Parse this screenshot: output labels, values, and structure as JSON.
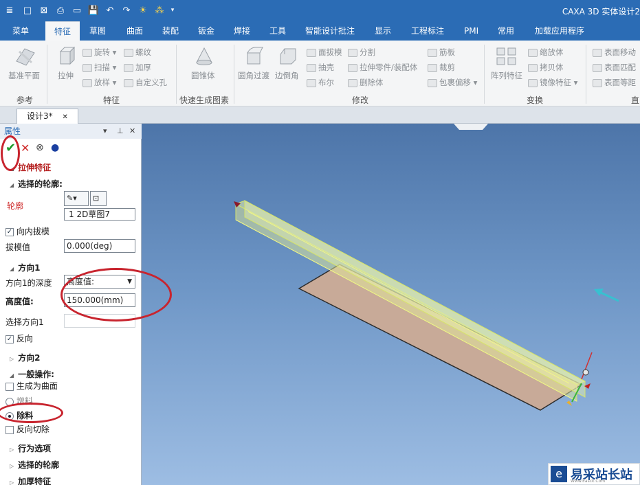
{
  "title_bar": {
    "app_title": "CAXA 3D 实体设计2",
    "quick_access": [
      "≣",
      "□",
      "⊠",
      "⎙",
      "▭",
      "💾",
      "↶",
      "↷",
      "☀",
      "⁂",
      "▾"
    ]
  },
  "menu": [
    "菜单",
    "特征",
    "草图",
    "曲面",
    "装配",
    "钣金",
    "焊接",
    "工具",
    "智能设计批注",
    "显示",
    "工程标注",
    "PMI",
    "常用",
    "加载应用程序"
  ],
  "active_menu": "特征",
  "ribbon": {
    "ref": {
      "label": "基准平面",
      "group": "参考"
    },
    "feature": {
      "big": "拉伸",
      "items": [
        "旋转 ▾",
        "扫描 ▾",
        "放样 ▾",
        "螺纹",
        "加厚",
        "自定义孔"
      ],
      "group": "特征"
    },
    "quick": {
      "big": "圆锥体",
      "group": "快速生成图素"
    },
    "modify": {
      "big1": "圆角过渡",
      "big2": "边倒角",
      "items": [
        "面拔模",
        "抽壳",
        "布尔",
        "分割",
        "拉伸零件/装配体",
        "删除体",
        "筋板",
        "裁剪",
        "包裹偏移 ▾"
      ],
      "group": "修改"
    },
    "transform": {
      "big": "阵列特征",
      "items": [
        "缩放体",
        "拷贝体",
        "镜像特征 ▾"
      ],
      "group": "变换"
    },
    "direct": {
      "items": [
        "表面移动",
        "表面匹配",
        "表面等距"
      ],
      "group": "直"
    }
  },
  "doc_tab": {
    "label": "设计3*",
    "close": "✕"
  },
  "panel": {
    "header": "属性",
    "header_controls": [
      "▾",
      "⊥",
      "✕"
    ],
    "toolbar": [
      "✔",
      "✕",
      "⊗",
      "●"
    ],
    "feature_title": "拉伸特征",
    "profile_section": "选择的轮廓:",
    "profile_label": "轮廓",
    "profile_value": "1   2D草图7",
    "draft_in": {
      "label": "向内拔模",
      "checked": true
    },
    "draft_value": {
      "label": "拔模值",
      "value": "0.000(deg)"
    },
    "dir1_section": "方向1",
    "dir1_depth": {
      "label": "方向1的深度",
      "value": "高度值:"
    },
    "height": {
      "label": "高度值:",
      "value": "150.000(mm)"
    },
    "select_dir": {
      "label": "选择方向1",
      "value": ""
    },
    "reverse": {
      "label": "反向",
      "checked": true
    },
    "dir2_section": "方向2",
    "general_section": "一般操作:",
    "make_surface": {
      "label": "生成为曲面",
      "checked": false
    },
    "add": {
      "label": "增料",
      "selected": false
    },
    "remove": {
      "label": "除料",
      "selected": true
    },
    "reverse_cut": {
      "label": "反向切除",
      "checked": false
    },
    "behavior_section": "行为选项",
    "selected_profile_section": "选择的轮廓",
    "thicken_section": "加厚特征"
  },
  "watermark": {
    "text": "易采站长站",
    "sub": "Www.Easck.Com"
  },
  "colors": {
    "accent": "#2b6cb5",
    "annotation": "#c8242e"
  }
}
